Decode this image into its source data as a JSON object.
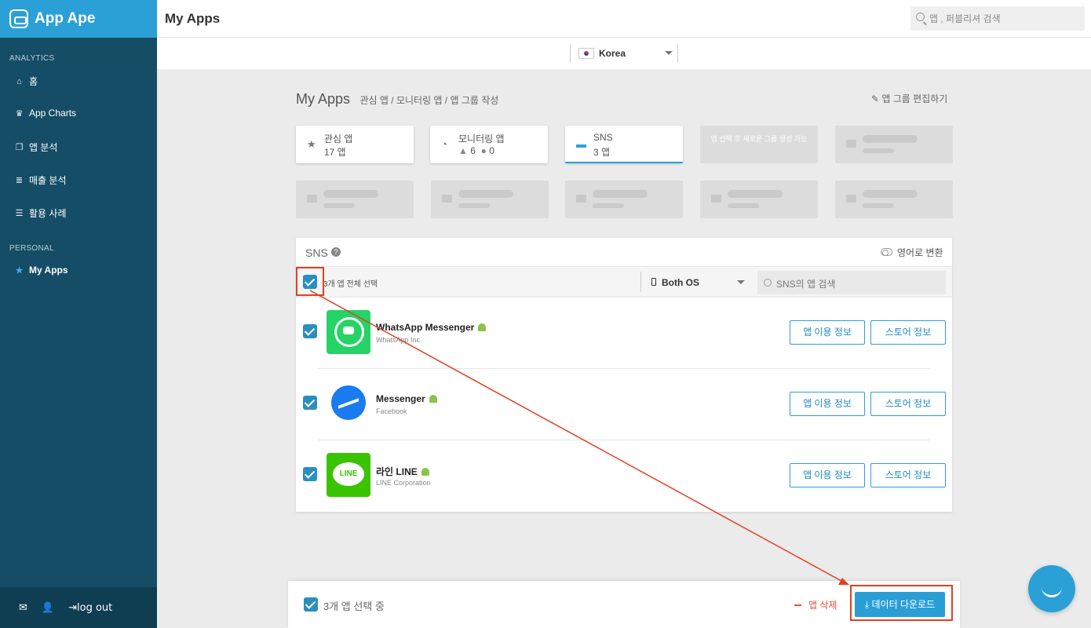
{
  "sidebar": {
    "logo": "App Ape",
    "section_analytics": "ANALYTICS",
    "items": [
      {
        "icon": "home-icon",
        "label": "홈"
      },
      {
        "icon": "trophy-icon",
        "label": "App Charts"
      },
      {
        "icon": "copy-icon",
        "label": "앱 분석"
      },
      {
        "icon": "database-icon",
        "label": "매출 분석"
      },
      {
        "icon": "list-icon",
        "label": "활용 사례"
      }
    ],
    "section_personal": "PERSONAL",
    "personal_item": {
      "icon": "star-icon",
      "label": "My Apps"
    },
    "logout": "log out"
  },
  "topbar": {
    "title": "My Apps",
    "search_placeholder": "앱 , 퍼블리셔 검색"
  },
  "country": {
    "selected": "Korea"
  },
  "page": {
    "heading": "My Apps",
    "subheading": "관심 앱 / 모니터링 앱 / 앱 그룹 작성",
    "edit_group": "앱 그룹 편집하기"
  },
  "groups": [
    {
      "name": "관심 앱",
      "count": "17 앱"
    },
    {
      "name": "모니터링 앱",
      "android": "6",
      "ios": "0"
    },
    {
      "name": "SNS",
      "count": "3 앱"
    }
  ],
  "group_placeholder_text": "앱 선택 후 새로운 그룹 생성 가능",
  "panel": {
    "title": "SNS",
    "translate_label": "영어로 변환",
    "select_all": "3개 앱 전체 선택",
    "os_filter": "Both OS",
    "search_placeholder": "SNS의 앱 검색",
    "apps": [
      {
        "name": "WhatsApp Messenger",
        "developer": "WhatsApp Inc.",
        "btn_usage": "앱 이용 정보",
        "btn_store": "스토어 정보"
      },
      {
        "name": "Messenger",
        "developer": "Facebook",
        "btn_usage": "앱 이용 정보",
        "btn_store": "스토어 정보"
      },
      {
        "name": "라인 LINE",
        "developer": "LINE Corporation",
        "btn_usage": "앱 이용 정보",
        "btn_store": "스토어 정보",
        "icon_text": "LINE"
      }
    ]
  },
  "bottom_bar": {
    "selected_text": "3개 앱 선택 중",
    "delete": "앱 삭제",
    "download": "데이터 다운로드"
  },
  "colors": {
    "sidebar": "#154d66",
    "accent": "#2aa0d6",
    "highlight": "#e2401f",
    "delete": "#e74c3c"
  }
}
